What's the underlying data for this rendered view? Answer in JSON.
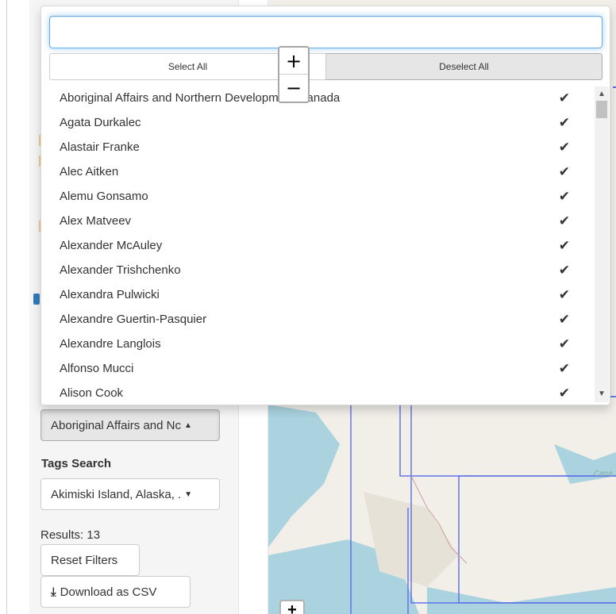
{
  "dropdown": {
    "search": {
      "value": "",
      "placeholder": ""
    },
    "select_all_label": "Select All",
    "deselect_all_label": "Deselect All",
    "check_glyph": "✔",
    "options": [
      {
        "label": "Aboriginal Affairs and Northern Development Canada",
        "selected": true
      },
      {
        "label": "Agata Durkalec",
        "selected": true
      },
      {
        "label": "Alastair Franke",
        "selected": true
      },
      {
        "label": "Alec Aitken",
        "selected": true
      },
      {
        "label": "Alemu Gonsamo",
        "selected": true
      },
      {
        "label": "Alex Matveev",
        "selected": true
      },
      {
        "label": "Alexander McAuley",
        "selected": true
      },
      {
        "label": "Alexander Trishchenko",
        "selected": true
      },
      {
        "label": "Alexandra Pulwicki",
        "selected": true
      },
      {
        "label": "Alexandre Guertin-Pasquier",
        "selected": true
      },
      {
        "label": "Alexandre Langlois",
        "selected": true
      },
      {
        "label": "Alfonso Mucci",
        "selected": true
      },
      {
        "label": "Alison Cook",
        "selected": true
      }
    ]
  },
  "map_zoom": {
    "zoom_in": "+",
    "zoom_out": "−",
    "bottom_stub": "+"
  },
  "map": {
    "partial_label": "Cana"
  },
  "sidebar": {
    "author_select_value": "Aboriginal Affairs and Nc",
    "tags_label": "Tags Search",
    "tags_select_value": "Akimiski Island, Alaska, .",
    "results_text": "Results: 13",
    "reset_label": "Reset Filters",
    "download_label": "Download as CSV"
  },
  "colors": {
    "accent_focus": "#66afe9",
    "map_water": "#aad3df",
    "map_land": "#f2efe9",
    "boundary_lines": "#5a6ee8"
  }
}
